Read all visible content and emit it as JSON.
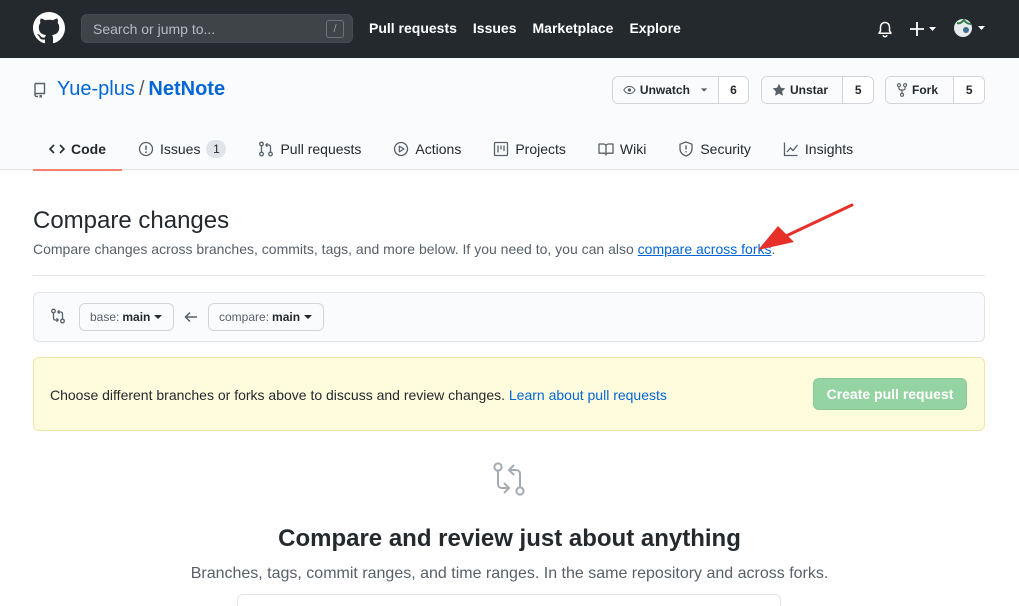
{
  "header": {
    "search_placeholder": "Search or jump to...",
    "search_key": "/",
    "nav": [
      "Pull requests",
      "Issues",
      "Marketplace",
      "Explore"
    ]
  },
  "repo": {
    "owner": "Yue-plus",
    "separator": "/",
    "name": "NetNote",
    "watch": {
      "label": "Unwatch",
      "count": "6"
    },
    "star": {
      "label": "Unstar",
      "count": "5"
    },
    "fork": {
      "label": "Fork",
      "count": "5"
    }
  },
  "tabs": [
    {
      "label": "Code",
      "icon": "code-icon",
      "active": true
    },
    {
      "label": "Issues",
      "icon": "issue-icon",
      "counter": "1"
    },
    {
      "label": "Pull requests",
      "icon": "pull-request-icon"
    },
    {
      "label": "Actions",
      "icon": "play-icon"
    },
    {
      "label": "Projects",
      "icon": "project-icon"
    },
    {
      "label": "Wiki",
      "icon": "book-icon"
    },
    {
      "label": "Security",
      "icon": "shield-icon"
    },
    {
      "label": "Insights",
      "icon": "graph-icon"
    }
  ],
  "compare": {
    "title": "Compare changes",
    "desc_prefix": "Compare changes across branches, commits, tags, and more below. If you need to, you can also ",
    "desc_link": "compare across forks",
    "desc_suffix": ".",
    "base_prefix": "base:",
    "base_value": "main",
    "compare_prefix": "compare:",
    "compare_value": "main"
  },
  "flash": {
    "text": "Choose different branches or forks above to discuss and review changes.",
    "link": "Learn about pull requests",
    "button": "Create pull request"
  },
  "blankslate": {
    "title": "Compare and review just about anything",
    "desc": "Branches, tags, commit ranges, and time ranges. In the same repository and across forks."
  },
  "colors": {
    "header_bg": "#24292e",
    "link": "#0366d6",
    "tab_underline": "#f9826c",
    "flash_bg": "#fffbdd",
    "create_button": "#94d3a2",
    "annotation_arrow": "#e8302b"
  }
}
